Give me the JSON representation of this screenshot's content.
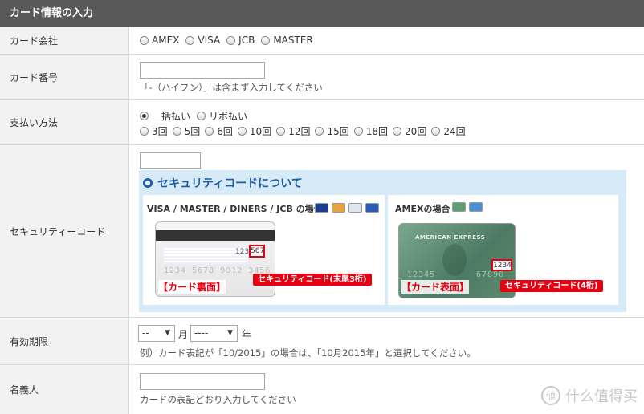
{
  "header": {
    "title": "カード情報の入力"
  },
  "card_company": {
    "label": "カード会社",
    "options": [
      "AMEX",
      "VISA",
      "JCB",
      "MASTER"
    ]
  },
  "card_number": {
    "label": "カード番号",
    "note": "「-（ハイフン）」は含まず入力してください"
  },
  "payment": {
    "label": "支払い方法",
    "options": [
      "一括払い",
      "リボ払い"
    ],
    "selected": "一括払い",
    "installments": [
      "3回",
      "5回",
      "6回",
      "10回",
      "12回",
      "15回",
      "18回",
      "20回",
      "24回"
    ]
  },
  "security": {
    "label": "セキュリティーコード",
    "title": "セキュリティコードについて",
    "panel_left_title": "VISA / MASTER / DINERS / JCB の場合",
    "panel_right_title": "AMEXの場合",
    "back_label": "【カード裏面】",
    "front_label": "【カード表面】",
    "callout_left": "セキュリティコード(末尾3桁)",
    "callout_right": "セキュリティコード(4桁)",
    "back_code_prefix": "1234",
    "back_code": "567",
    "back_number": "1234 5678 9012 3456",
    "amex_brand": "AMERICAN EXPRESS",
    "amex_code": "1234",
    "amex_number_left": "12345",
    "amex_number_right": "67890"
  },
  "expiry": {
    "label": "有効期限",
    "month_value": "--",
    "month_unit": "月",
    "year_value": "----",
    "year_unit": "年",
    "note": "例）カード表記が「10/2015」の場合は、「10月2015年」と選択してください。"
  },
  "holder": {
    "label": "名義人",
    "note": "カードの表記どおり入力してください"
  },
  "watermark": {
    "text": "什么值得买",
    "icon": "値"
  },
  "colors": {
    "accent": "#1f5fa8",
    "alert": "#e60012",
    "header_bg": "#595959",
    "label_bg": "#f2f2f2",
    "info_bg": "#d6eaf8"
  }
}
